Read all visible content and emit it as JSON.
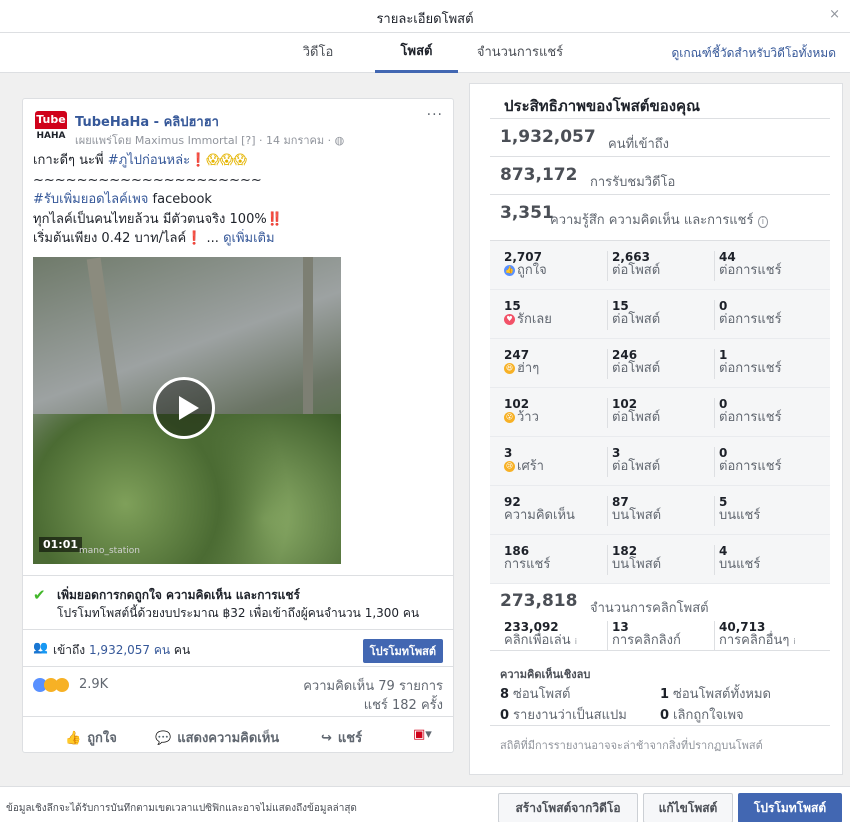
{
  "dialog": {
    "title": "รายละเอียดโพสต์",
    "close": "×"
  },
  "tabs": [
    {
      "label": "วิดีโอ"
    },
    {
      "label": "โพสต์"
    },
    {
      "label": "จำนวนการแชร์"
    }
  ],
  "guide_link": "ดูเกณฑ์ชี้วัดสำหรับวิดีโอทั้งหมด",
  "post": {
    "page_name": "TubeHaHa - คลิปฮาฮา",
    "logo_top": "Tube",
    "logo_bottom": "HAHA",
    "published_by": "เผยแพร่โดย Maximus Immortal [?] · 14 มกราคม · ",
    "menu": "···",
    "line1_text": "เกาะดีๆ นะพี่ ",
    "line1_tag": "#ภูไปก่อนหล่ะ",
    "line1_mark": "❗",
    "line1_emoji": "😱😱😱",
    "line2": "~~~~~~~~~~~~~~~~~~~~~",
    "line3_tag": "#รับเพิ่มยอดไลค์เพจ",
    "line3_text": " facebook",
    "line4_text": "ทุกไลค์เป็นคนไทยล้วน มีตัวตนจริง 100%",
    "line4_mark": "‼️",
    "line5_text": "เริ่มต้นเพียง 0.42 บาท/ไลค์",
    "line5_mark": "❗",
    "line5_more_prefix": " ... ",
    "see_more": "ดูเพิ่มเติม",
    "video_duration": "01:01",
    "video_watermark": "mano_station",
    "boost_heading": "เพิ่มยอดการกดถูกใจ ความคิดเห็น และการแชร์",
    "boost_sub": "โปรโมทโพสต์นี้ด้วยงบประมาณ ฿32 เพื่อเข้าถึงผู้คนจำนวน 1,300 คน",
    "reach_prefix": "เข้าถึง ",
    "reach_value": "1,932,057 คน",
    "reach_suffix": " คน",
    "boost_button": "โปรโมทโพสต์",
    "reaction_count": "2.9K",
    "comments_count": "ความคิดเห็น 79 รายการ",
    "shares_count": "แชร์ 182 ครั้ง",
    "action_like": "ถูกใจ",
    "action_comment": "แสดงความคิดเห็น",
    "action_share": "แชร์"
  },
  "stats": {
    "title": "ประสิทธิภาพของโพสต์ของคุณ",
    "reach": {
      "value": "1,932,057",
      "label": "คนที่เข้าถึง"
    },
    "views": {
      "value": "873,172",
      "label": "การรับชมวิดีโอ"
    },
    "engagement": {
      "value": "3,351",
      "label": "ความรู้สึก ความคิดเห็น และการแชร์",
      "info": "i"
    },
    "rows": [
      {
        "icon": "like-icon",
        "cells": [
          {
            "v": "2,707",
            "d": "ถูกใจ"
          },
          {
            "v": "2,663",
            "d": "ต่อโพสต์"
          },
          {
            "v": "44",
            "d": "ต่อการแชร์"
          }
        ]
      },
      {
        "icon": "love-icon",
        "cells": [
          {
            "v": "15",
            "d": "รักเลย"
          },
          {
            "v": "15",
            "d": "ต่อโพสต์"
          },
          {
            "v": "0",
            "d": "ต่อการแชร์"
          }
        ]
      },
      {
        "icon": "haha-icon",
        "cells": [
          {
            "v": "247",
            "d": "ฮ่าๆ"
          },
          {
            "v": "246",
            "d": "ต่อโพสต์"
          },
          {
            "v": "1",
            "d": "ต่อการแชร์"
          }
        ]
      },
      {
        "icon": "wow-icon",
        "cells": [
          {
            "v": "102",
            "d": "ว้าว"
          },
          {
            "v": "102",
            "d": "ต่อโพสต์"
          },
          {
            "v": "0",
            "d": "ต่อการแชร์"
          }
        ]
      },
      {
        "icon": "sad-icon",
        "cells": [
          {
            "v": "3",
            "d": "เศร้า"
          },
          {
            "v": "3",
            "d": "ต่อโพสต์"
          },
          {
            "v": "0",
            "d": "ต่อการแชร์"
          }
        ]
      },
      {
        "icon": "",
        "cells": [
          {
            "v": "92",
            "d": "ความคิดเห็น"
          },
          {
            "v": "87",
            "d": "บนโพสต์"
          },
          {
            "v": "5",
            "d": "บนแชร์"
          }
        ]
      },
      {
        "icon": "",
        "cells": [
          {
            "v": "186",
            "d": "การแชร์"
          },
          {
            "v": "182",
            "d": "บนโพสต์"
          },
          {
            "v": "4",
            "d": "บนแชร์"
          }
        ]
      }
    ],
    "clicks": {
      "value": "273,818",
      "label": "จำนวนการคลิกโพสต์",
      "cells": [
        {
          "v": "233,092",
          "d": "คลิกเพื่อเล่น",
          "info": "i"
        },
        {
          "v": "13",
          "d": "การคลิกลิงก์"
        },
        {
          "v": "40,713",
          "d": "การคลิกอื่นๆ",
          "info": "i"
        }
      ]
    },
    "negative": {
      "heading": "ความคิดเห็นเชิงลบ",
      "items": [
        {
          "v": "8",
          "label": "ซ่อนโพสต์"
        },
        {
          "v": "1",
          "label": "ซ่อนโพสต์ทั้งหมด"
        },
        {
          "v": "0",
          "label": "รายงานว่าเป็นสแปม"
        },
        {
          "v": "0",
          "label": "เลิกถูกใจเพจ"
        }
      ]
    },
    "footnote": "สถิติที่มีการรายงานอาจจะล่าช้าจากสิ่งที่ปรากฏบนโพสต์"
  },
  "footer": {
    "note": "ข้อมูลเชิงลึกจะได้รับการบันทึกตามเขตเวลาแปซิฟิกและอาจไม่แสดงถึงข้อมูลล่าสุด",
    "create_button": "สร้างโพสต์จากวิดีโอ",
    "edit_button": "แก้ไขโพสต์",
    "boost_button": "โปรโมทโพสต์"
  },
  "colors": {
    "accent": "#4267b2",
    "link": "#365899",
    "success": "#42b72a",
    "like": "#5890ff",
    "love": "#f25268",
    "haha": "#f7b125"
  }
}
